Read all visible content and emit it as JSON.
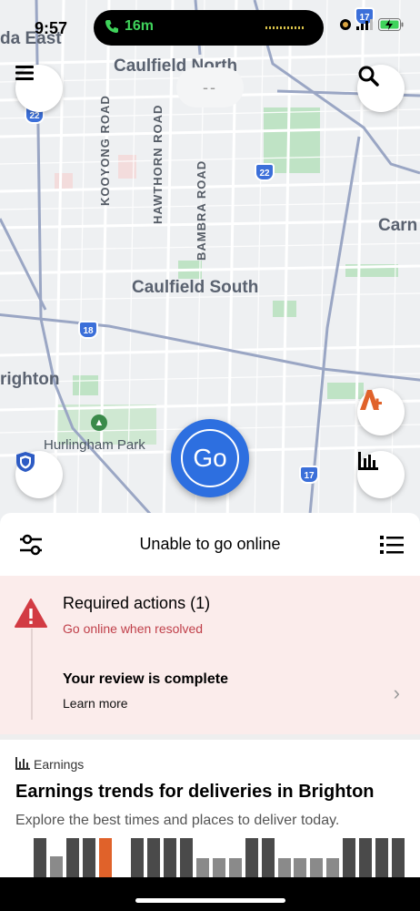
{
  "status_bar": {
    "time": "9:57",
    "call_duration": "16m"
  },
  "map": {
    "labels": {
      "caulfield_north": "Caulfield North",
      "caulfield_south": "Caulfield South",
      "carnegie": "Carn",
      "brighton": "righton",
      "elsternwick": "da East",
      "hurlingham_park": "Hurlingham Park"
    },
    "roads": {
      "kooyong": "KOOYONG ROAD",
      "hawthorn": "HAWTHORN ROAD",
      "bambra": "BAMBRA ROAD"
    },
    "route_shields": [
      "22",
      "22",
      "18",
      "17",
      "17"
    ],
    "top_pill": "--",
    "go_label": "Go"
  },
  "sheet": {
    "title": "Unable to go online",
    "alert": {
      "title": "Required actions (1)",
      "subtitle": "Go online when resolved",
      "item_title": "Your review is complete",
      "item_link": "Learn more"
    },
    "earnings": {
      "label": "Earnings",
      "title": "Earnings trends for deliveries in Brighton",
      "subtitle": "Explore the best times and places to deliver today.",
      "bar_levels": [
        1,
        0.55,
        1,
        1,
        1,
        0,
        1,
        1,
        1,
        1,
        0.5,
        0.5,
        0.5,
        1,
        1,
        0.5,
        0.5,
        0.5,
        0.5,
        1,
        1,
        1,
        1
      ],
      "highlight_index": 4,
      "colors": {
        "dark": "#4a4a4a",
        "light": "#8a8a8a",
        "highlight": "#e0622a"
      }
    }
  },
  "colors": {
    "go_blue": "#2d6fe0",
    "alert_red": "#d23b43",
    "route_blue": "#3b6fd9"
  }
}
